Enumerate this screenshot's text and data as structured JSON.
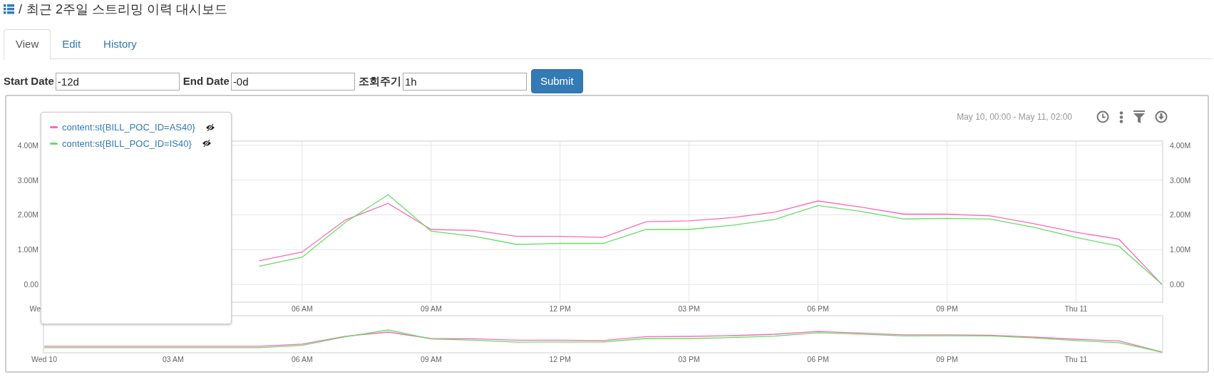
{
  "breadcrumb": {
    "separator": "/",
    "title": "최근 2주일 스트리밍 이력 대시보드"
  },
  "tabs": [
    {
      "label": "View",
      "selected": true
    },
    {
      "label": "Edit",
      "selected": false
    },
    {
      "label": "History",
      "selected": false
    }
  ],
  "form": {
    "fields": [
      {
        "label": "Start Date",
        "value": "-12d"
      },
      {
        "label": "End Date",
        "value": "-0d"
      },
      {
        "label": "조회주기",
        "value": "1h"
      }
    ],
    "submit": "Submit"
  },
  "chart": {
    "range": "May 10, 00:00 - May 11, 02:00",
    "chart_data": {
      "type": "line",
      "grid": true,
      "categories": [
        "We",
        null,
        null,
        null,
        null,
        null,
        "06 AM",
        null,
        null,
        "09 AM",
        null,
        null,
        "12 PM",
        null,
        null,
        "03 PM",
        null,
        null,
        "06 PM",
        null,
        null,
        "09 PM",
        null,
        null,
        "Thu 11",
        null,
        null
      ],
      "ylim": [
        -510000,
        4120000
      ],
      "yticks": [
        {
          "value": 0,
          "label": "0.00"
        },
        {
          "value": 1000000,
          "label": "1.00M"
        },
        {
          "value": 2000000,
          "label": "2.00M"
        },
        {
          "value": 3000000,
          "label": "3.00M"
        },
        {
          "value": 4000000,
          "label": "4.00M"
        }
      ],
      "series": [
        {
          "name": "content:st{BILL_POC_ID=AS40}",
          "color": "#ff69b4",
          "values": [
            null,
            null,
            null,
            null,
            null,
            680000,
            930000,
            1850000,
            2330000,
            1580000,
            1550000,
            1380000,
            1380000,
            1350000,
            1800000,
            1830000,
            1920000,
            2080000,
            2400000,
            2220000,
            2020000,
            2020000,
            1970000,
            1750000,
            1500000,
            1300000,
            0
          ]
        },
        {
          "name": "content:st{BILL_POC_ID=IS40}",
          "color": "#66dd66",
          "values": [
            null,
            null,
            null,
            null,
            null,
            520000,
            780000,
            1780000,
            2580000,
            1530000,
            1380000,
            1150000,
            1180000,
            1180000,
            1580000,
            1580000,
            1700000,
            1870000,
            2270000,
            2100000,
            1880000,
            1900000,
            1880000,
            1650000,
            1350000,
            1100000,
            0
          ]
        }
      ]
    },
    "right_axis": {
      "labels": [
        "4.00M",
        "3.00M",
        "2.00M",
        "1.00M",
        "0.00"
      ]
    },
    "navigator": {
      "x_labels": [
        "Wed 10",
        "03 AM",
        "06 AM",
        "09 AM",
        "12 PM",
        "03 PM",
        "06 PM",
        "09 PM",
        "Thu 11"
      ]
    }
  }
}
